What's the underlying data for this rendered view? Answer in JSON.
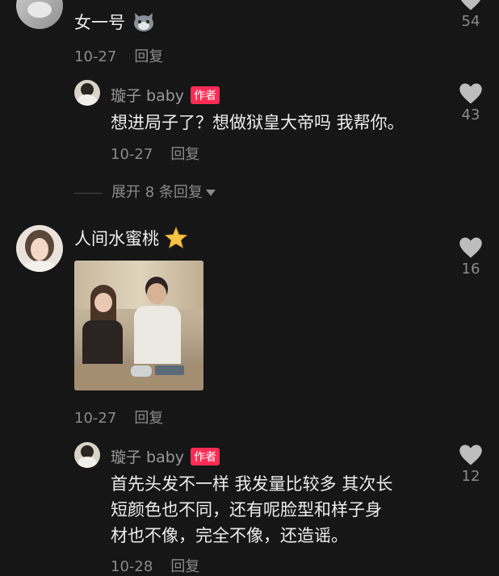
{
  "comments": [
    {
      "name": "女一号",
      "date": "10-27",
      "reply_label": "回复",
      "likes": "54"
    },
    {
      "name": "璇子 baby",
      "badge": "作者",
      "text": "想进局子了？想做狱皇大帝吗 我帮你。",
      "date": "10-27",
      "reply_label": "回复",
      "likes": "43"
    },
    {
      "name": "人间水蜜桃",
      "date": "10-27",
      "reply_label": "回复",
      "likes": "16"
    },
    {
      "name": "璇子 baby",
      "badge": "作者",
      "text_lines": [
        "首先头发不一样 我发量比较多 其次长",
        "短颜色也不同，还有呢脸型和样子身",
        "材也不像，完全不像，还造谣。"
      ],
      "date": "10-28",
      "reply_label": "回复",
      "likes": "12"
    }
  ],
  "expand_replies": "展开 8 条回复",
  "icons": {
    "like": "heart-icon",
    "emoji_cat": "cat-face-emoji-icon",
    "emoji_star": "star-emoji-icon"
  },
  "colors": {
    "background": "#161616",
    "badge": "#fe2c55"
  }
}
